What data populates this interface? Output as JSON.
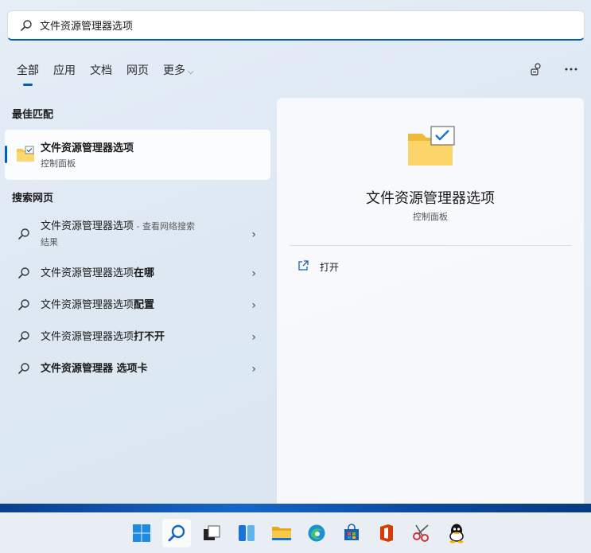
{
  "search": {
    "query": "文件资源管理器选项",
    "icon": "search-icon"
  },
  "tabs": [
    {
      "label": "全部",
      "active": true
    },
    {
      "label": "应用"
    },
    {
      "label": "文档"
    },
    {
      "label": "网页"
    },
    {
      "label": "更多"
    }
  ],
  "sections": {
    "best_match": "最佳匹配",
    "web_search": "搜索网页"
  },
  "best_match": {
    "title": "文件资源管理器选项",
    "subtitle": "控制面板"
  },
  "web_results": [
    {
      "main": "文件资源管理器选项",
      "suffix": " - 查看网络搜索",
      "line2": "结果"
    },
    {
      "main": "文件资源管理器选项",
      "bold": "在哪"
    },
    {
      "main": "文件资源管理器选项",
      "bold": "配置"
    },
    {
      "main": "文件资源管理器选项",
      "bold": "打不开"
    },
    {
      "main": "文件资源管理器",
      "bold": " 选项卡"
    }
  ],
  "detail": {
    "title": "文件资源管理器选项",
    "subtitle": "控制面板",
    "open_label": "打开"
  },
  "colors": {
    "accent": "#005fb8",
    "folder": "#f6c64a",
    "check": "#1a73d9"
  },
  "taskbar": {
    "icons": [
      "windows-start-icon",
      "search-icon",
      "task-view-icon",
      "widgets-icon",
      "file-explorer-icon",
      "edge-icon",
      "store-icon",
      "office-icon",
      "snipping-tool-icon",
      "qq-icon"
    ]
  }
}
